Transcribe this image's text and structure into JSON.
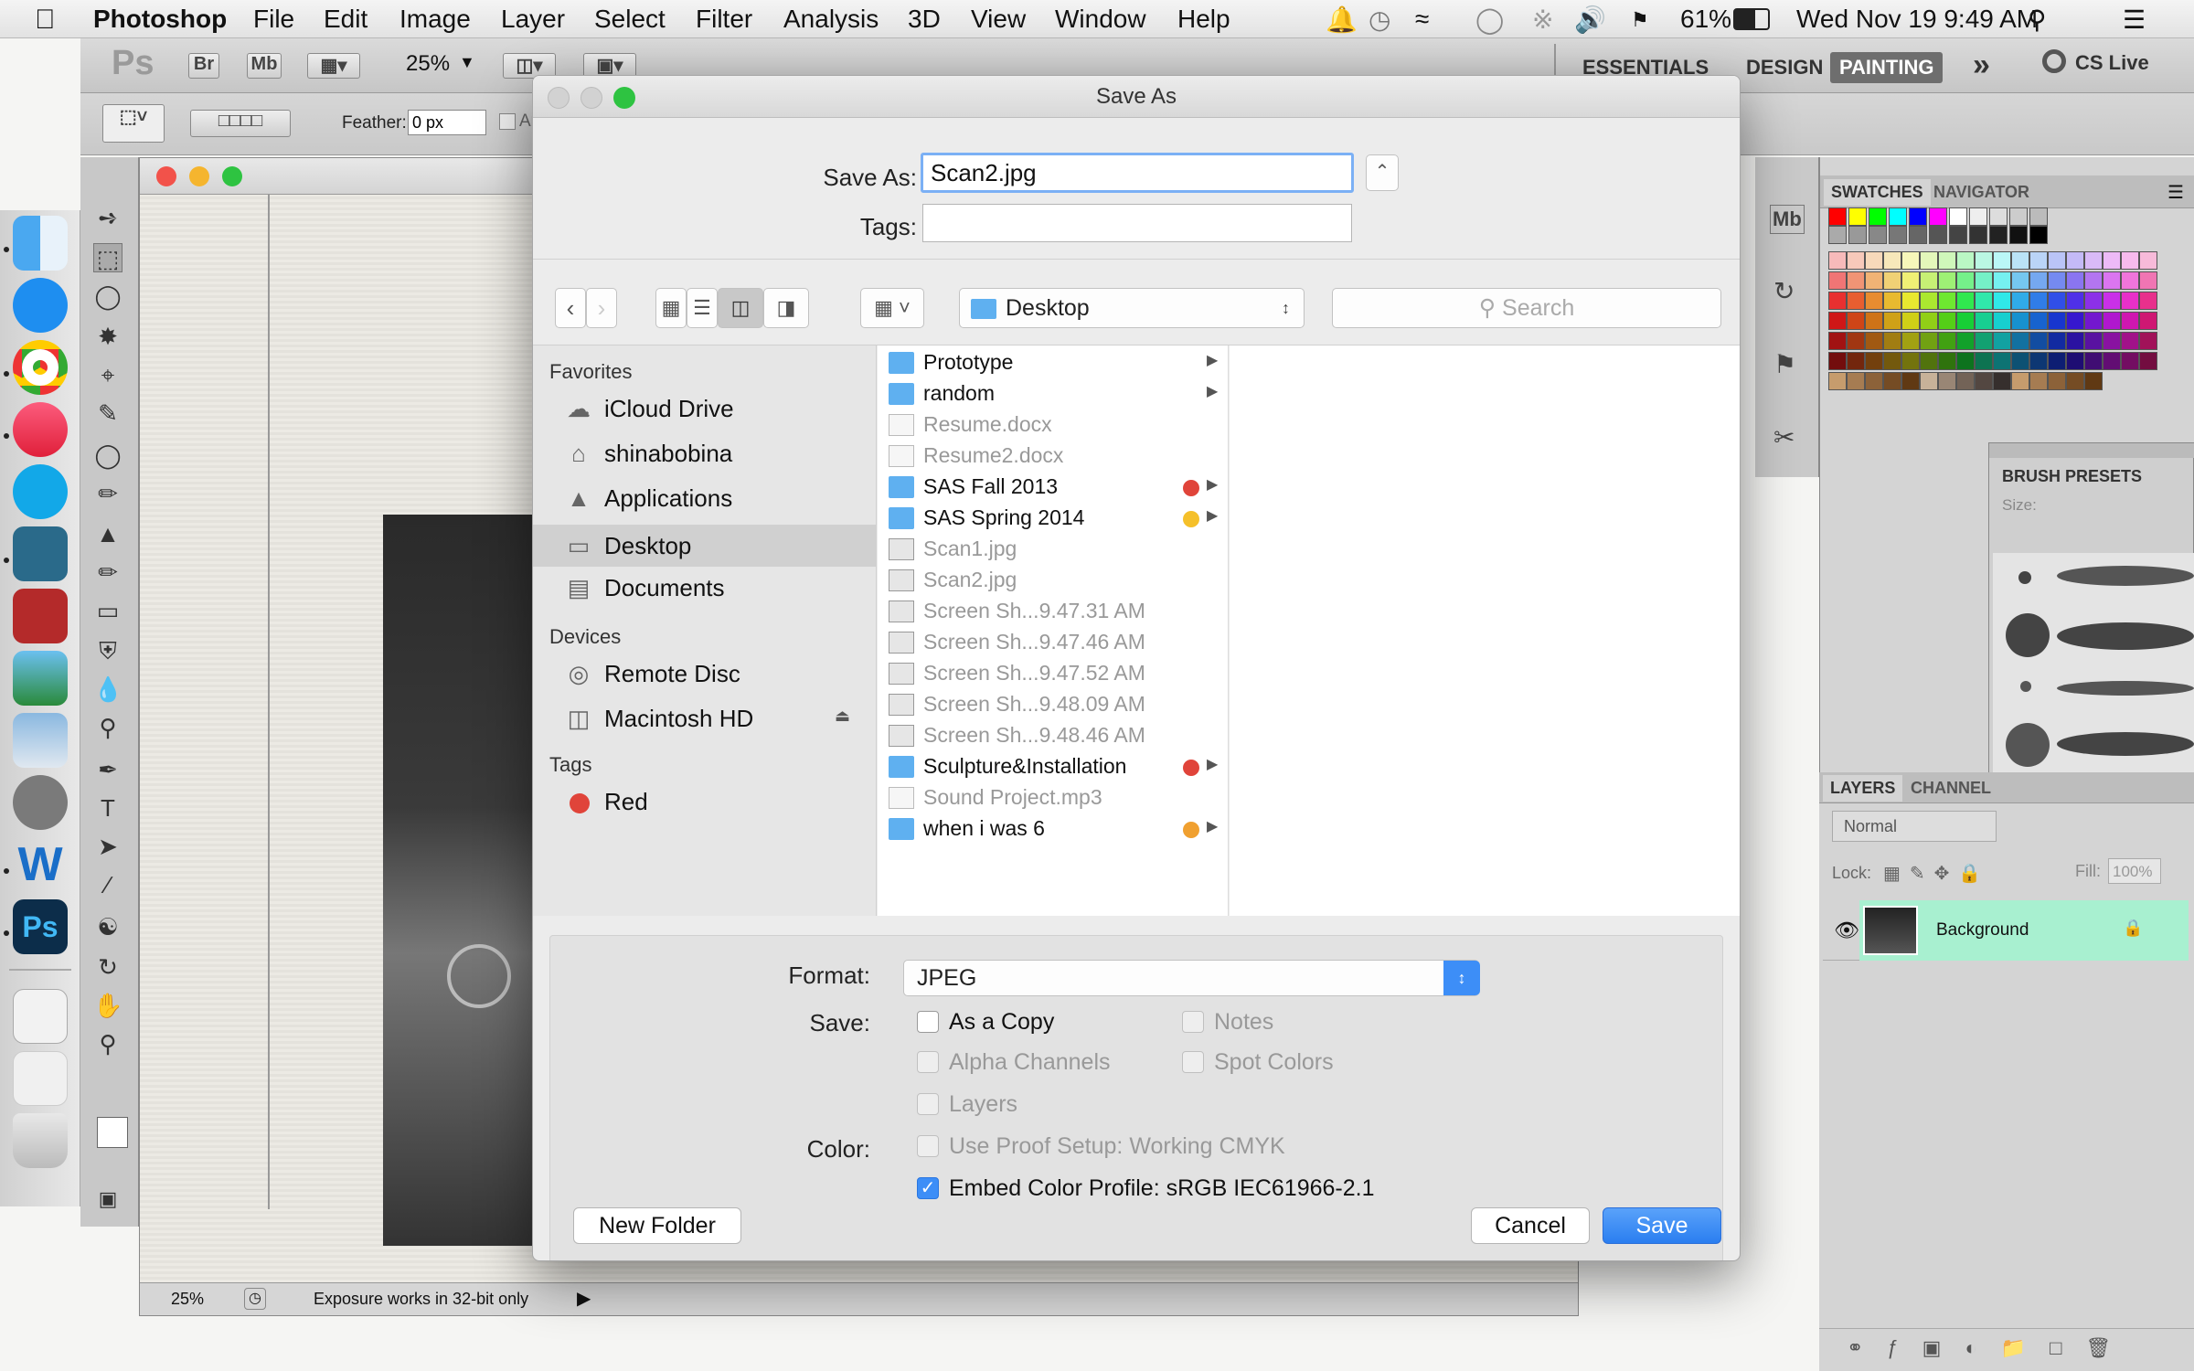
{
  "menubar": {
    "apple": "",
    "app": "Photoshop",
    "items": [
      "File",
      "Edit",
      "Image",
      "Layer",
      "Select",
      "Filter",
      "Analysis",
      "3D",
      "View",
      "Window",
      "Help"
    ],
    "battery": "61%",
    "datetime": "Wed Nov 19  9:49 AM"
  },
  "psbar": {
    "logo": "Ps",
    "br": "Br",
    "mb": "Mb",
    "zoom": "25%",
    "workspaces": [
      "ESSENTIALS",
      "DESIGN",
      "PAINTING"
    ],
    "active_workspace": "PAINTING",
    "more": "»",
    "cslive": "CS Live"
  },
  "options": {
    "feather_label": "Feather:",
    "feather_value": "0 px",
    "anti_alias": "An"
  },
  "document": {
    "status_zoom": "25%",
    "status_text": "Exposure works in 32-bit only"
  },
  "panels": {
    "swatches_tab": "SWATCHES",
    "navigator_tab": "NAVIGATOR",
    "brush_presets": "BRUSH PRESETS",
    "brush_size_label": "Size:",
    "layers_tab": "LAYERS",
    "channels_tab": "CHANNEL",
    "blend_mode": "Normal",
    "lock_label": "Lock:",
    "fill_label": "Fill:",
    "fill_value": "100%",
    "layer_name": "Background"
  },
  "dialog": {
    "title": "Save As",
    "save_as_label": "Save As:",
    "filename": "Scan2.jpg",
    "tags_label": "Tags:",
    "tags_value": "",
    "location": "Desktop",
    "search_placeholder": "Search",
    "favorites_header": "Favorites",
    "favorites": [
      "iCloud Drive",
      "shinabobina",
      "Applications",
      "Desktop",
      "Documents"
    ],
    "devices_header": "Devices",
    "devices": [
      "Remote Disc",
      "Macintosh HD"
    ],
    "tags_header": "Tags",
    "tags": [
      "Red"
    ],
    "files": [
      {
        "name": "Prototype",
        "kind": "folder",
        "tag": "",
        "arrow": true
      },
      {
        "name": "random",
        "kind": "folder",
        "tag": "",
        "arrow": true
      },
      {
        "name": "Resume.docx",
        "kind": "doc",
        "tag": "",
        "arrow": false
      },
      {
        "name": "Resume2.docx",
        "kind": "doc",
        "tag": "",
        "arrow": false
      },
      {
        "name": "SAS Fall 2013",
        "kind": "folder",
        "tag": "#e0443a",
        "arrow": true
      },
      {
        "name": "SAS Spring 2014",
        "kind": "folder",
        "tag": "#f5c02a",
        "arrow": true
      },
      {
        "name": "Scan1.jpg",
        "kind": "img",
        "tag": "",
        "arrow": false
      },
      {
        "name": "Scan2.jpg",
        "kind": "img",
        "tag": "",
        "arrow": false
      },
      {
        "name": "Screen Sh...9.47.31 AM",
        "kind": "img",
        "tag": "",
        "arrow": false
      },
      {
        "name": "Screen Sh...9.47.46 AM",
        "kind": "img",
        "tag": "",
        "arrow": false
      },
      {
        "name": "Screen Sh...9.47.52 AM",
        "kind": "img",
        "tag": "",
        "arrow": false
      },
      {
        "name": "Screen Sh...9.48.09 AM",
        "kind": "img",
        "tag": "",
        "arrow": false
      },
      {
        "name": "Screen Sh...9.48.46 AM",
        "kind": "img",
        "tag": "",
        "arrow": false
      },
      {
        "name": "Sculpture&Installation",
        "kind": "folder",
        "tag": "#e0443a",
        "arrow": true
      },
      {
        "name": "Sound Project.mp3",
        "kind": "doc",
        "tag": "",
        "arrow": false
      },
      {
        "name": "when i was 6",
        "kind": "folder",
        "tag": "#f0a030",
        "arrow": true
      }
    ],
    "format_label": "Format:",
    "format_value": "JPEG",
    "save_label": "Save:",
    "as_copy": "As a Copy",
    "notes": "Notes",
    "alpha_channels": "Alpha Channels",
    "spot_colors": "Spot Colors",
    "layers": "Layers",
    "color_label": "Color:",
    "use_proof": "Use Proof Setup:  Working CMYK",
    "embed_profile": "Embed Color Profile:  sRGB IEC61966-2.1",
    "new_folder": "New Folder",
    "cancel": "Cancel",
    "save": "Save"
  },
  "colors": {
    "accent": "#3d8ef7",
    "tag_red": "#e0443a",
    "tag_yellow": "#f5c02a",
    "tag_orange": "#f0a030",
    "layer_highlight": "#a8f0d0"
  }
}
